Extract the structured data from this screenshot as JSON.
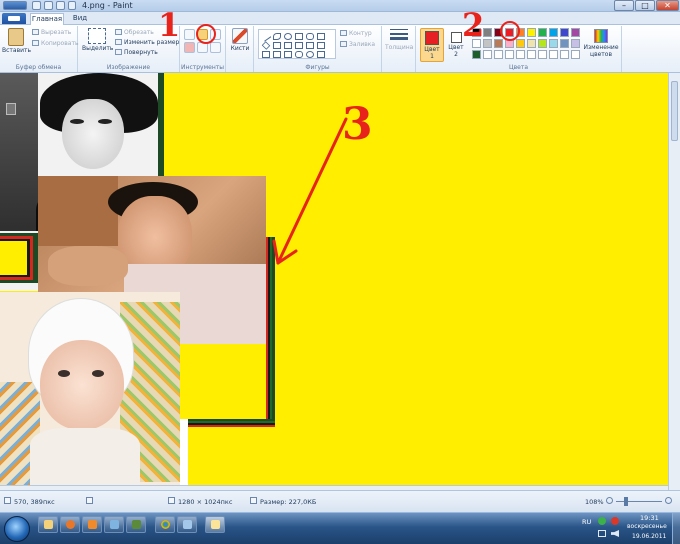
{
  "window": {
    "title": "4.png - Paint",
    "controls": {
      "minimize": "–",
      "maximize": "□",
      "close": "✕"
    }
  },
  "tabs": [
    {
      "label": "Главная",
      "active": true
    },
    {
      "label": "Вид",
      "active": false
    }
  ],
  "ribbon": {
    "clipboard": {
      "group_label": "Буфер обмена",
      "paste": "Вставить",
      "cut": "Вырезать",
      "copy": "Копировать"
    },
    "image": {
      "group_label": "Изображение",
      "select": "Выделить",
      "crop": "Обрезать",
      "resize": "Изменить размер",
      "rotate": "Повернуть"
    },
    "tools": {
      "group_label": "Инструменты"
    },
    "brushes": {
      "label": "Кисти"
    },
    "shapes": {
      "group_label": "Фигуры",
      "outline": "Контур",
      "fill": "Заливка"
    },
    "size": {
      "label": "Толщина"
    },
    "colors": {
      "group_label": "Цвета",
      "color1_label": "Цвет",
      "color1_num": "1",
      "color2_label": "Цвет",
      "color2_num": "2",
      "edit_colors_line1": "Изменение",
      "edit_colors_line2": "цветов",
      "color1_value": "#e61f24",
      "color2_value": "#ffffff",
      "palette_row1": [
        "#000000",
        "#7f7f7f",
        "#880015",
        "#ed1c24",
        "#ff7f27",
        "#fff200",
        "#22b14c",
        "#00a2e8",
        "#3f48cc",
        "#a349a4"
      ],
      "palette_row2": [
        "#ffffff",
        "#c3c3c3",
        "#b97a57",
        "#ffaec9",
        "#ffc90e",
        "#efe4b0",
        "#b5e61d",
        "#99d9ea",
        "#7092be",
        "#c8bfe7"
      ],
      "palette_row3": [
        "#1d5e2a",
        "#ffffff",
        "#ffffff",
        "#ffffff",
        "#ffffff",
        "#ffffff",
        "#ffffff",
        "#ffffff",
        "#ffffff",
        "#ffffff"
      ]
    }
  },
  "canvas": {
    "background": "#ffee00"
  },
  "annotations": {
    "one": "1",
    "two": "2",
    "three": "3"
  },
  "statusbar": {
    "cursor_pos": "570, 389пкс",
    "image_size": "1280 × 1024пкс",
    "file_size": "Размер: 227,0КБ",
    "zoom": "108%"
  },
  "taskbar": {
    "lang": "RU",
    "time": "19:31",
    "day": "воскресенье",
    "date": "19.06.2011"
  }
}
